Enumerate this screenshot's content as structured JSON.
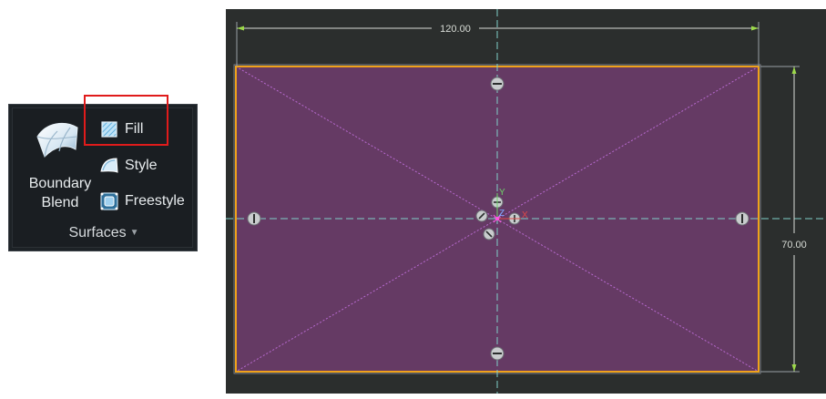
{
  "ribbon": {
    "group_label": "Surfaces",
    "boundary_blend": {
      "line1": "Boundary",
      "line2": "Blend",
      "icon": "boundary-blend-icon"
    },
    "commands": [
      {
        "label": "Fill",
        "icon": "fill-icon"
      },
      {
        "label": "Style",
        "icon": "style-icon"
      },
      {
        "label": "Freestyle",
        "icon": "freestyle-icon"
      }
    ]
  },
  "sketch": {
    "width_dimension": "120.00",
    "height_dimension": "70.00",
    "axis_labels": {
      "y": "Y",
      "x": "X",
      "z": "Z"
    },
    "colors": {
      "background": "#2b2e2d",
      "fill": "#653a64",
      "outline": "#f0a21a",
      "centerline": "#7fd0c9",
      "dimension": "#9cd84a"
    }
  }
}
